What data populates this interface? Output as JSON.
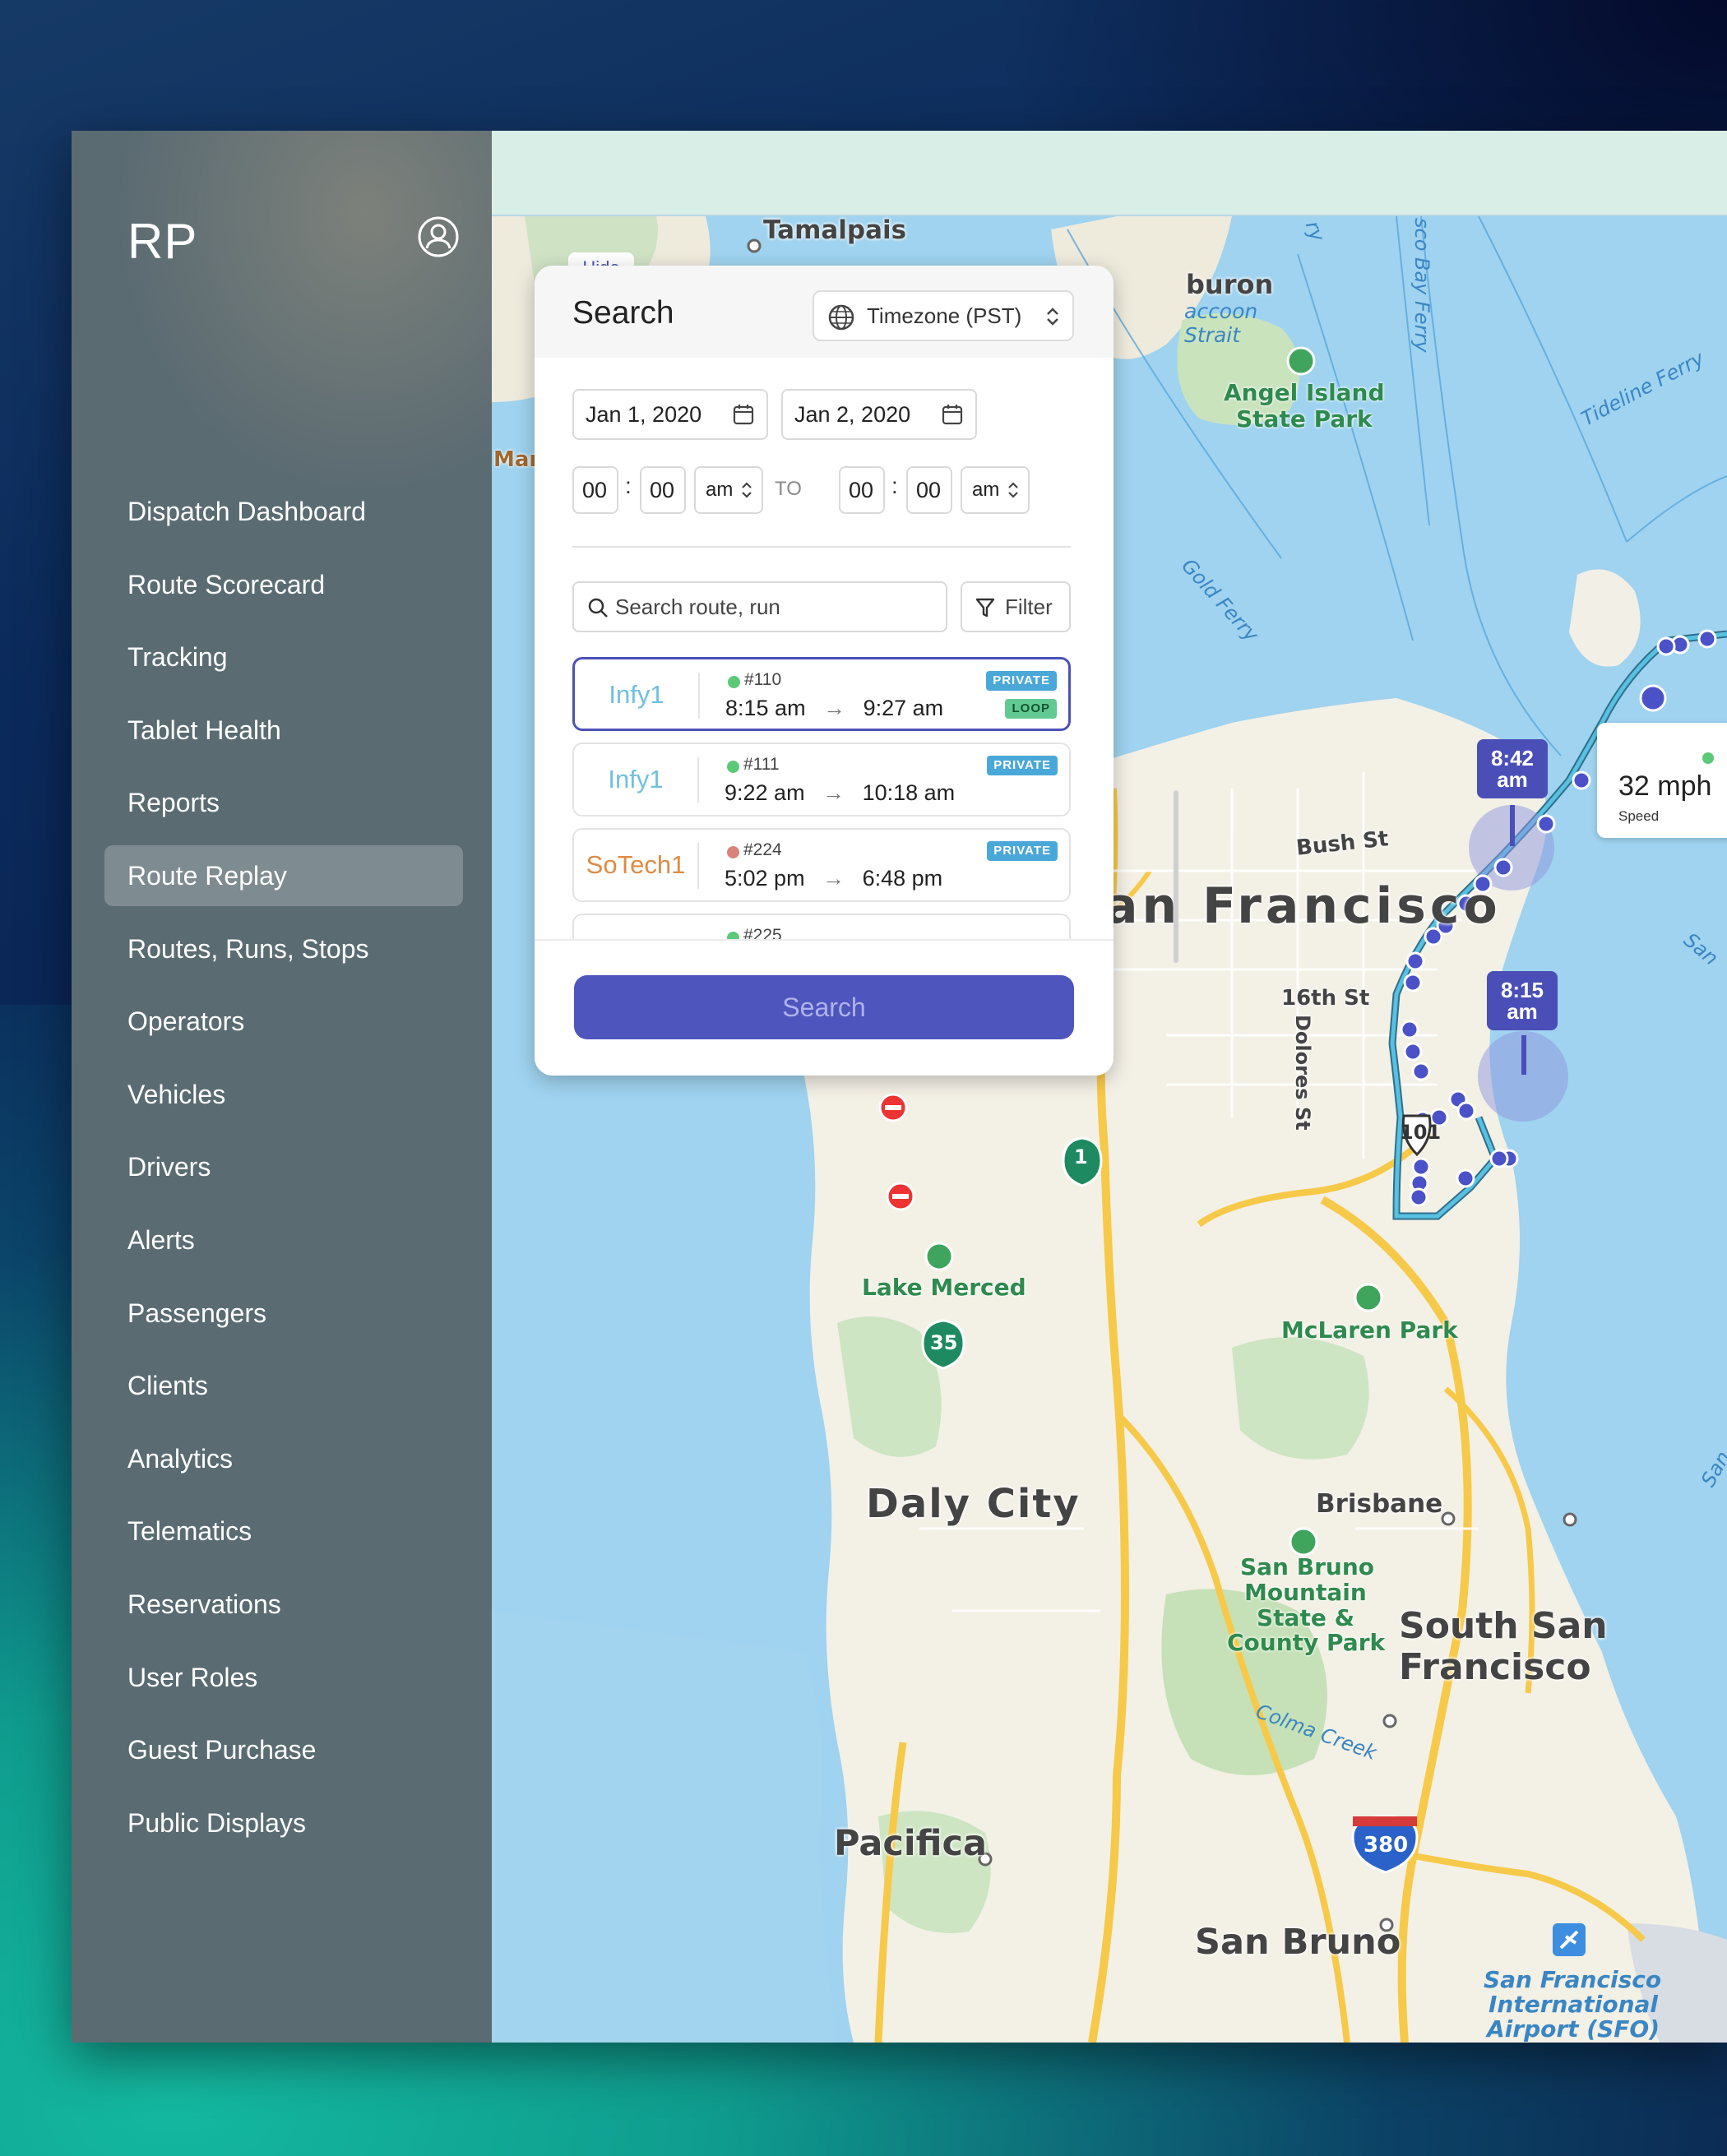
{
  "app": {
    "logo_text": "RP"
  },
  "sidebar": {
    "items": [
      {
        "label": "Dispatch Dashboard",
        "active": false
      },
      {
        "label": "Route Scorecard",
        "active": false
      },
      {
        "label": "Tracking",
        "active": false
      },
      {
        "label": "Tablet Health",
        "active": false
      },
      {
        "label": "Reports",
        "active": false
      },
      {
        "label": "Route Replay",
        "active": true
      },
      {
        "label": "Routes, Runs, Stops",
        "active": false
      },
      {
        "label": "Operators",
        "active": false
      },
      {
        "label": "Vehicles",
        "active": false
      },
      {
        "label": "Drivers",
        "active": false
      },
      {
        "label": "Alerts",
        "active": false
      },
      {
        "label": "Passengers",
        "active": false
      },
      {
        "label": "Clients",
        "active": false
      },
      {
        "label": "Analytics",
        "active": false
      },
      {
        "label": "Telematics",
        "active": false
      },
      {
        "label": "Reservations",
        "active": false
      },
      {
        "label": "User Roles",
        "active": false
      },
      {
        "label": "Guest Purchase",
        "active": false
      },
      {
        "label": "Public Displays",
        "active": false
      }
    ]
  },
  "search_panel": {
    "hide_label": "Hide",
    "title": "Search",
    "timezone_label": "Timezone (PST)",
    "start_date": "Jan 1, 2020",
    "end_date": "Jan 2, 2020",
    "start_time": {
      "hour": "00",
      "minute": "00",
      "ampm": "am"
    },
    "to_label": "TO",
    "end_time": {
      "hour": "00",
      "minute": "00",
      "ampm": "am"
    },
    "search_placeholder": "Search route, run",
    "filter_label": "Filter",
    "routes": [
      {
        "name": "Infy1",
        "run": "#110",
        "start": "8:15 am",
        "end": "9:27 am",
        "badges": [
          "PRIVATE",
          "LOOP"
        ],
        "status_color": "#5cc977",
        "name_color": "#6fc0de"
      },
      {
        "name": "Infy1",
        "run": "#111",
        "start": "9:22 am",
        "end": "10:18 am",
        "badges": [
          "PRIVATE"
        ],
        "status_color": "#5cc977",
        "name_color": "#6fc0de"
      },
      {
        "name": "SoTech1",
        "run": "#224",
        "start": "5:02 pm",
        "end": "6:48 pm",
        "badges": [
          "PRIVATE"
        ],
        "status_color": "#d9837a",
        "name_color": "#e08a43"
      },
      {
        "name": "",
        "run": "#225",
        "start": "",
        "end": "",
        "badges": [],
        "status_color": "#5cc977",
        "name_color": "#6fc0de"
      }
    ],
    "search_button_label": "Search"
  },
  "map": {
    "time_flags": [
      {
        "time": "8:42",
        "ampm": "am"
      },
      {
        "time": "8:15",
        "ampm": "am"
      }
    ],
    "speed_card": {
      "value": "32 mph",
      "label": "Speed"
    },
    "places": {
      "tamalpais": "Tamalpais",
      "tiburon": "buron",
      "raccoon": "accoon",
      "strait": "Strait",
      "angel_island_1": "Angel Island",
      "angel_island_2": "State Park",
      "marin": "Mar",
      "san_francisco": "an Francisco",
      "bush_st": "Bush St",
      "sixteenth_st": "16th St",
      "dolores_st": "Dolores St",
      "lake_merced": "Lake Merced",
      "mclaren_park": "McLaren Park",
      "daly_city": "Daly City",
      "brisbane": "Brisbane",
      "san_bruno_mtn": [
        "San Bruno",
        "Mountain",
        "State &",
        "County Park"
      ],
      "south_sf_1": "South San",
      "south_sf_2": "Francisco",
      "colma_creek": "Colma Creek",
      "pacifica": "Pacifica",
      "san_bruno": "San Bruno",
      "sfo": [
        "San Francisco",
        "International",
        "Airport (SFO)"
      ],
      "tideline_ferry": "Tideline Ferry",
      "gold_ferry": "Gold Ferry",
      "bay_ferry": "sco Bay Ferry",
      "ry": "ry",
      "san_right_1": "San",
      "san_right_2": "San"
    },
    "highway_shields": {
      "hwy1": "1",
      "hwy35": "35",
      "i380": "380",
      "us101": "101"
    }
  }
}
